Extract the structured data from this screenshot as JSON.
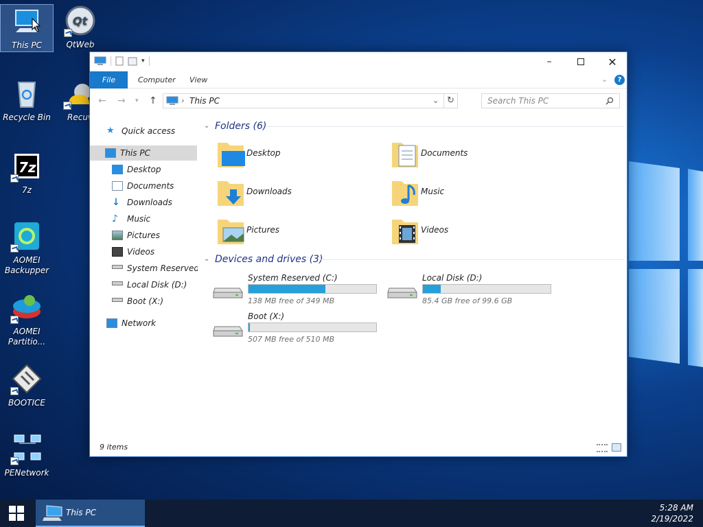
{
  "desktop": {
    "icons": [
      {
        "label": "This PC"
      },
      {
        "label": "QtWeb"
      },
      {
        "label": "Recycle Bin"
      },
      {
        "label": "Recuv"
      },
      {
        "label": "7z"
      },
      {
        "label": "AOMEI Backupper"
      },
      {
        "label": "AOMEI Partitio..."
      },
      {
        "label": "BOOTICE"
      },
      {
        "label": "PENetwork"
      }
    ]
  },
  "window": {
    "ribbon_tabs": [
      "File",
      "Computer",
      "View"
    ],
    "address": {
      "path": "This PC"
    },
    "search": {
      "placeholder": "Search This PC"
    },
    "nav": {
      "quick_access": "Quick access",
      "this_pc": "This PC",
      "items": [
        "Desktop",
        "Documents",
        "Downloads",
        "Music",
        "Pictures",
        "Videos",
        "System Reserved (C:)",
        "Local Disk (D:)",
        "Boot (X:)"
      ],
      "network": "Network"
    },
    "folders": {
      "header": "Folders (6)",
      "items": [
        "Desktop",
        "Documents",
        "Downloads",
        "Music",
        "Pictures",
        "Videos"
      ]
    },
    "devices": {
      "header": "Devices and drives (3)",
      "drives": [
        {
          "name": "System Reserved (C:)",
          "free": "138 MB free of 349 MB",
          "used_pct": 60
        },
        {
          "name": "Local Disk (D:)",
          "free": "85.4 GB free of 99.6 GB",
          "used_pct": 14
        },
        {
          "name": "Boot (X:)",
          "free": "507 MB free of 510 MB",
          "used_pct": 1
        }
      ]
    },
    "status": "9 items"
  },
  "taskbar": {
    "task_label": "This PC",
    "time": "5:28 AM",
    "date": "2/19/2022"
  },
  "colors": {
    "accent": "#1979ca",
    "drive_fill": "#26a0da",
    "taskbar": "#0e1d35"
  }
}
